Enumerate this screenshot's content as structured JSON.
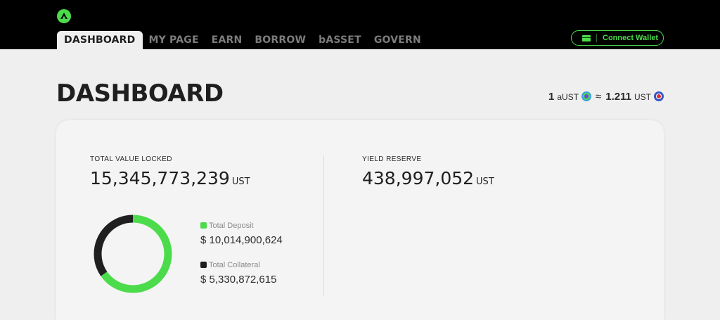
{
  "nav": {
    "items": [
      {
        "label": "DASHBOARD",
        "active": true
      },
      {
        "label": "MY PAGE",
        "active": false
      },
      {
        "label": "EARN",
        "active": false
      },
      {
        "label": "BORROW",
        "active": false
      },
      {
        "label": "bASSET",
        "active": false
      },
      {
        "label": "GOVERN",
        "active": false
      }
    ],
    "wallet_label": "Connect Wallet"
  },
  "page": {
    "title": "DASHBOARD",
    "rate": {
      "base_amount": "1",
      "base_unit": "aUST",
      "approx": "≈",
      "quote_amount": "1.211",
      "quote_unit": "UST"
    }
  },
  "tvl": {
    "label": "TOTAL VALUE LOCKED",
    "value": "15,345,773,239",
    "unit": "UST"
  },
  "yield_reserve": {
    "label": "YIELD RESERVE",
    "value": "438,997,052",
    "unit": "UST"
  },
  "legend": {
    "deposit_label": "Total Deposit",
    "deposit_value": "$ 10,014,900,624",
    "collateral_label": "Total Collateral",
    "collateral_value": "$ 5,330,872,615"
  },
  "chart_data": {
    "type": "pie",
    "categories": [
      "Total Deposit",
      "Total Collateral"
    ],
    "values": [
      10014900624,
      5330872615
    ],
    "colors": [
      "#4bdb4b",
      "#1f1f1f"
    ]
  },
  "colors": {
    "accent": "#4bdb4b",
    "dark": "#1f1f1f",
    "header_bg": "#000000",
    "page_bg": "#efefef"
  }
}
